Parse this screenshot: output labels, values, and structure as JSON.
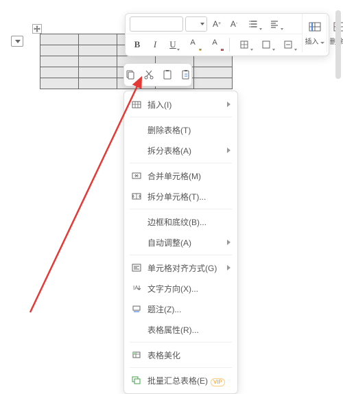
{
  "toolbar": {
    "insert_label": "插入",
    "delete_label": "删除"
  },
  "context_menu": {
    "items": [
      {
        "label": "插入(I)",
        "icon": "insert",
        "arrow": true
      },
      {
        "label": "删除表格(T)",
        "icon": "delete-table"
      },
      {
        "label": "拆分表格(A)",
        "icon": "",
        "arrow": true
      },
      {
        "label": "合并单元格(M)",
        "icon": "merge-cells"
      },
      {
        "label": "拆分单元格(T)...",
        "icon": "split-cells"
      },
      {
        "label": "边框和底纹(B)...",
        "icon": ""
      },
      {
        "label": "自动调整(A)",
        "icon": "",
        "arrow": true
      },
      {
        "label": "单元格对齐方式(G)",
        "icon": "align",
        "arrow": true
      },
      {
        "label": "文字方向(X)...",
        "icon": "text-direction"
      },
      {
        "label": "题注(Z)...",
        "icon": "caption"
      },
      {
        "label": "表格属性(R)...",
        "icon": ""
      },
      {
        "label": "表格美化",
        "icon": "beautify"
      },
      {
        "label": "批量汇总表格(E)",
        "icon": "batch",
        "vip": true
      }
    ]
  },
  "vip_badge": "VIP"
}
